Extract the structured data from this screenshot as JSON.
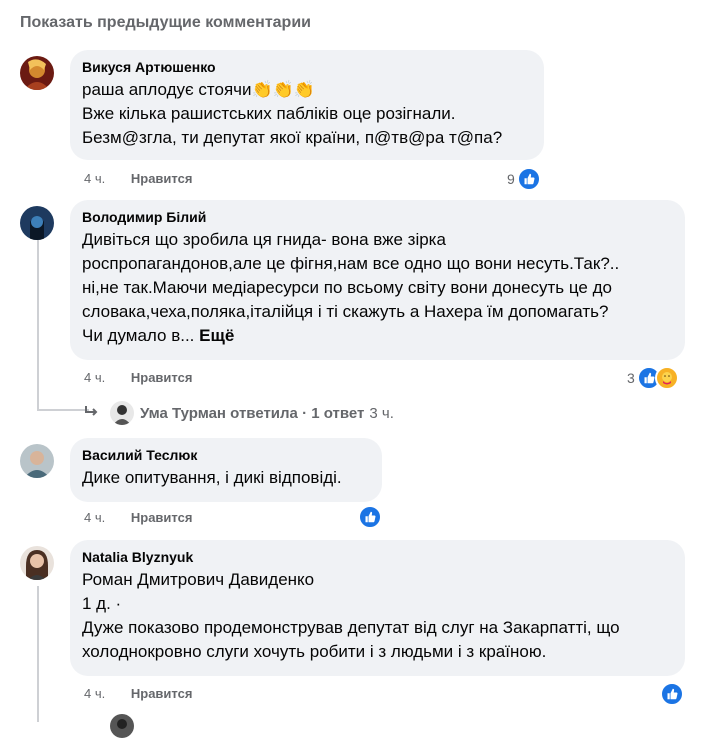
{
  "show_previous": "Показать предыдущие комментарии",
  "comments": [
    {
      "author": "Викуся Артюшенко",
      "lines": [
        "раша аплодує стоячи👏👏👏",
        "Вже кілька рашистських пабліків оце розігнали.",
        "Безм@згла, ти депутат якої країни, п@тв@ра т@па?"
      ],
      "time": "4 ч.",
      "like_label": "Нравится",
      "reaction_count": "9"
    },
    {
      "author": "Володимир Білий",
      "lines": [
        "Дивіться що зробила ця гнида- вона вже зірка",
        "роспропагандонов,але це фігня,нам все одно що вони несуть.Так?..",
        "ні,не так.Маючи медіаресурси по всьому світу вони донесуть це до",
        "словака,чеха,поляка,італійця і ті скажуть а Нахера їм допомагать?",
        "Чи думало в..."
      ],
      "more_label": "Ещё",
      "time": "4 ч.",
      "like_label": "Нравится",
      "reaction_count": "3",
      "reply_summary": {
        "text": "Ума Турман ответила · 1 ответ",
        "time": "3 ч."
      }
    },
    {
      "author": "Василий Теслюк",
      "lines": [
        "Дике опитування, і дикі відповіді."
      ],
      "time": "4 ч.",
      "like_label": "Нравится"
    },
    {
      "author": "Natalia Blyznyuk",
      "lines": [
        "Роман Дмитрович Давиденко",
        "1 д. ·",
        "Дуже показово продемонстрував депутат від слуг на Закарпатті, що",
        "холоднокровно слуги хочуть робити і з людьми і з країною."
      ],
      "time": "4 ч.",
      "like_label": "Нравится"
    }
  ],
  "colors": {
    "bubble": "#f0f2f5",
    "muted": "#65676b",
    "like_blue": "#1b74e4",
    "care_yellow": "#f7b125"
  }
}
